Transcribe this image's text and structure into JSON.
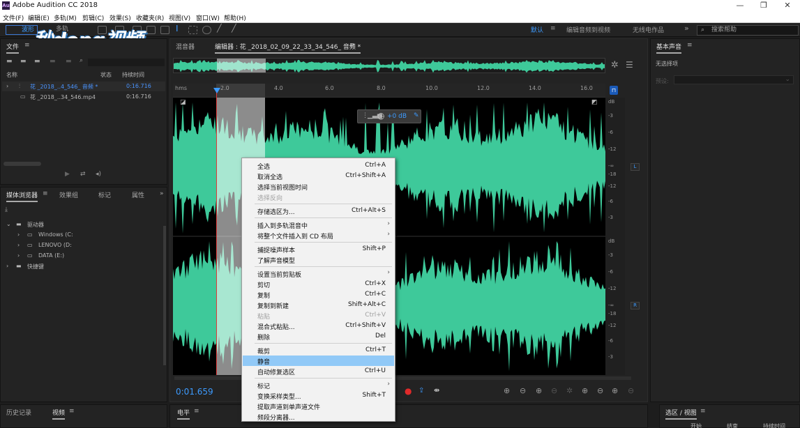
{
  "app": {
    "title": "Adobe Audition CC 2018",
    "icon_label": "Au"
  },
  "menubar": [
    "文件(F)",
    "编辑(E)",
    "多轨(M)",
    "剪辑(C)",
    "效果(S)",
    "收藏夹(R)",
    "视图(V)",
    "窗口(W)",
    "帮助(H)"
  ],
  "toolbar": {
    "waveform_label": "波形",
    "multitrack_label": "多轨",
    "workspaces": [
      "默认",
      "编辑音频到视频",
      "无线电作品"
    ],
    "search_placeholder": "搜索帮助"
  },
  "watermark": "秒dong视频",
  "files_panel": {
    "tab": "文件",
    "columns": [
      "名称",
      "状态",
      "持续时间"
    ],
    "rows": [
      {
        "name": "花 _2018_..4_546_ 音频 *",
        "duration": "0:16.716"
      },
      {
        "name": "花 _2018_..34_546.mp4",
        "duration": "0:16.716"
      }
    ]
  },
  "media_panel": {
    "tabs": [
      "媒体浏览器",
      "效果组",
      "标记",
      "属性"
    ],
    "tree_root": "驱动器",
    "drives": [
      "Windows (C:",
      "LENOVO (D:",
      "DATA (E:)"
    ],
    "shortcuts": "快捷键"
  },
  "editor": {
    "tabs": [
      "混音器",
      "编辑器 : 花 _2018_02_09_22_33_34_546_ 音频 *"
    ],
    "ruler_unit": "hms",
    "ruler_ticks": [
      "2.0",
      "4.0",
      "6.0",
      "8.0",
      "10.0",
      "12.0",
      "14.0",
      "16.0"
    ],
    "db_label": "dB",
    "db_ticks": [
      "-3",
      "-6",
      "-12",
      "-∞",
      "-18",
      "-12",
      "-6",
      "-3"
    ],
    "channels": [
      "L",
      "R"
    ],
    "hud_value": "+0 dB",
    "current_time": "0:01.659",
    "waveform_color": "#3ec99a"
  },
  "right_panel": {
    "title": "基本声音",
    "subtitle": "无选择项",
    "preset_label": "预设:"
  },
  "bottom": {
    "left_tabs": [
      "历史记录",
      "视频"
    ],
    "center_tab": "电平",
    "right_tab": "选区 / 视图",
    "right_columns": [
      "开始",
      "结束",
      "持续时间"
    ]
  },
  "context_menu": {
    "items": [
      {
        "label": "全选",
        "shortcut": "Ctrl+A"
      },
      {
        "label": "取消全选",
        "shortcut": "Ctrl+Shift+A"
      },
      {
        "label": "选择当前视图时间",
        "shortcut": ""
      },
      {
        "label": "选择反向",
        "shortcut": "",
        "disabled": true
      },
      {
        "sep": true
      },
      {
        "label": "存储选区为...",
        "shortcut": "Ctrl+Alt+S"
      },
      {
        "sep": true
      },
      {
        "label": "插入到多轨混音中",
        "shortcut": "",
        "submenu": true
      },
      {
        "label": "将整个文件插入到 CD 布局",
        "shortcut": "",
        "submenu": true
      },
      {
        "sep": true
      },
      {
        "label": "捕捉噪声样本",
        "shortcut": "Shift+P"
      },
      {
        "label": "了解声音模型",
        "shortcut": ""
      },
      {
        "sep": true
      },
      {
        "label": "设置当前剪贴板",
        "shortcut": "",
        "submenu": true
      },
      {
        "label": "剪切",
        "shortcut": "Ctrl+X"
      },
      {
        "label": "复制",
        "shortcut": "Ctrl+C"
      },
      {
        "label": "复制到新建",
        "shortcut": "Shift+Alt+C"
      },
      {
        "label": "粘贴",
        "shortcut": "Ctrl+V",
        "disabled": true
      },
      {
        "label": "混合式粘贴...",
        "shortcut": "Ctrl+Shift+V"
      },
      {
        "label": "删除",
        "shortcut": "Del"
      },
      {
        "sep": true
      },
      {
        "label": "裁剪",
        "shortcut": "Ctrl+T"
      },
      {
        "label": "静音",
        "shortcut": "",
        "highlighted": true
      },
      {
        "label": "自动修复选区",
        "shortcut": "Ctrl+U"
      },
      {
        "sep": true
      },
      {
        "label": "标记",
        "shortcut": "",
        "submenu": true
      },
      {
        "label": "变换采样类型...",
        "shortcut": "Shift+T"
      },
      {
        "label": "提取声道到单声道文件",
        "shortcut": ""
      },
      {
        "label": "频段分离器...",
        "shortcut": ""
      }
    ]
  }
}
